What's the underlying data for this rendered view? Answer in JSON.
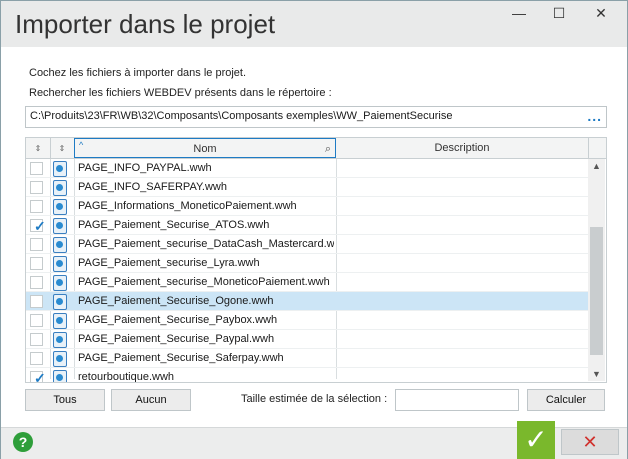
{
  "window": {
    "title": "Importer dans le projet",
    "min_glyph": "—",
    "max_glyph": "☐",
    "close_glyph": "✕"
  },
  "instructions": {
    "line1": "Cochez les fichiers à importer dans le projet.",
    "line2": "Rechercher les fichiers WEBDEV présents dans le répertoire :"
  },
  "path": {
    "value": "C:\\Produits\\23\\FR\\WB\\32\\Composants\\Composants exemples\\WW_PaiementSecurise",
    "browse_glyph": "..."
  },
  "table": {
    "columns": {
      "nom": "Nom",
      "description": "Description"
    },
    "rows": [
      {
        "name": "PAGE_INFO_PAYPAL.wwh",
        "checked": false,
        "selected": false
      },
      {
        "name": "PAGE_INFO_SAFERPAY.wwh",
        "checked": false,
        "selected": false
      },
      {
        "name": "PAGE_Informations_MoneticoPaiement.wwh",
        "checked": false,
        "selected": false
      },
      {
        "name": "PAGE_Paiement_Securise_ATOS.wwh",
        "checked": true,
        "selected": false
      },
      {
        "name": "PAGE_Paiement_securise_DataCash_Mastercard.wwh",
        "checked": false,
        "selected": false
      },
      {
        "name": "PAGE_Paiement_securise_Lyra.wwh",
        "checked": false,
        "selected": false
      },
      {
        "name": "PAGE_Paiement_securise_MoneticoPaiement.wwh",
        "checked": false,
        "selected": false
      },
      {
        "name": "PAGE_Paiement_Securise_Ogone.wwh",
        "checked": false,
        "selected": true
      },
      {
        "name": "PAGE_Paiement_Securise_Paybox.wwh",
        "checked": false,
        "selected": false
      },
      {
        "name": "PAGE_Paiement_Securise_Paypal.wwh",
        "checked": false,
        "selected": false
      },
      {
        "name": "PAGE_Paiement_Securise_Saferpay.wwh",
        "checked": false,
        "selected": false
      },
      {
        "name": "retourboutique.wwh",
        "checked": true,
        "selected": false
      }
    ]
  },
  "actions": {
    "tous": "Tous",
    "aucun": "Aucun",
    "size_label": "Taille estimée de la sélection :",
    "size_value": "",
    "calculer": "Calculer"
  },
  "footer": {
    "help_glyph": "?",
    "ok_glyph": "✓",
    "cancel_glyph": "✕"
  },
  "colors": {
    "accent": "#1e7bc4",
    "ok_green": "#7ab82c",
    "cancel_red": "#d0312d",
    "selected_row": "#cce5f6"
  }
}
